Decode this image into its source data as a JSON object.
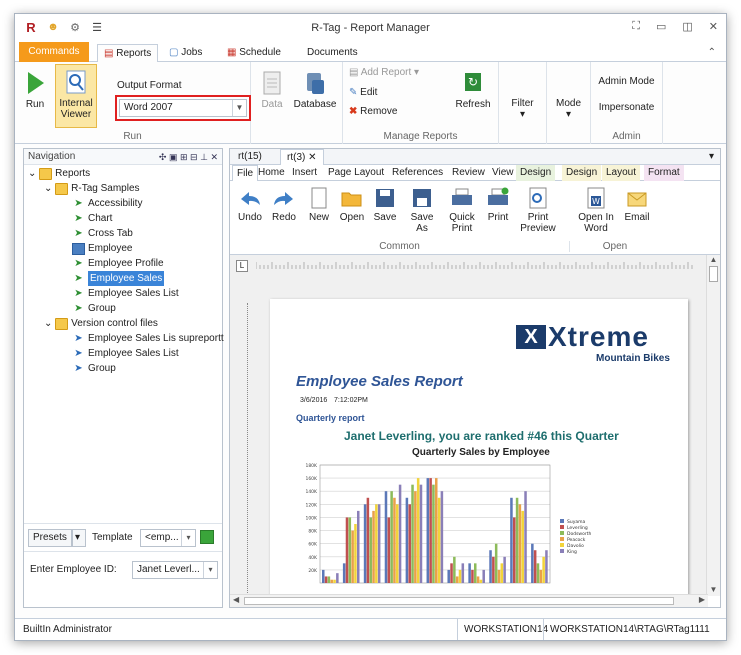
{
  "window": {
    "title": "R-Tag - Report Manager"
  },
  "tabs": [
    "Commands",
    "Reports",
    "Jobs",
    "Schedule",
    "Documents"
  ],
  "ribbon": {
    "run": "Run",
    "internal_viewer_line1": "Internal",
    "internal_viewer_line2": "Viewer",
    "output_format_label": "Output Format",
    "output_format_value": "Word 2007",
    "run_group": "Run",
    "data": "Data",
    "database": "Database",
    "add_report": "Add Report",
    "edit": "Edit",
    "remove": "Remove",
    "refresh": "Refresh",
    "manage_group": "Manage Reports",
    "filter": "Filter",
    "mode": "Mode",
    "admin_mode": "Admin Mode",
    "impersonate": "Impersonate",
    "admin_group": "Admin"
  },
  "navigation": {
    "title": "Navigation",
    "items": [
      "Reports",
      "R-Tag Samples",
      "Accessibility",
      "Chart",
      "Cross Tab",
      "Employee",
      "Employee  Profile",
      "Employee  Sales",
      "Employee Sales List",
      "Group",
      "Version control files",
      "Employee Sales Lis  supreportt",
      "Employee Sales List",
      "Group"
    ],
    "presets": "Presets",
    "template_label": "Template",
    "template_value": "<emp...",
    "employee_id_label": "Enter Employee ID:",
    "employee_id_value": "Janet Leverl..."
  },
  "doc": {
    "tabs": [
      "rt(15)",
      "rt(3)"
    ],
    "ribbon_tabs": [
      "File",
      "Home",
      "Insert",
      "Page Layout",
      "References",
      "Review",
      "View",
      "Design",
      "Design",
      "Layout",
      "Format"
    ],
    "buttons": [
      "Undo",
      "Redo",
      "New",
      "Open",
      "Save",
      "Save As",
      "Quick Print",
      "Print",
      "Print Preview",
      "Open In Word",
      "Email"
    ],
    "common_group": "Common",
    "open_group": "Open"
  },
  "report": {
    "logo_main": "Xtreme",
    "logo_sub": "Mountain Bikes",
    "title": "Employee Sales Report",
    "date": "3/6/2016",
    "time": "7:12:02PM",
    "quarterly": "Quarterly report",
    "headline": "Janet Leverling, you are ranked #46 this Quarter",
    "chart_title": "Quarterly Sales by Employee"
  },
  "chart_data": {
    "type": "bar",
    "title": "Quarterly Sales by Employee",
    "y_ticks": [
      "180K",
      "160K",
      "140K",
      "120K",
      "100K",
      "80K",
      "60K",
      "40K",
      "20K"
    ],
    "ylim": [
      0,
      180000
    ],
    "series": [
      {
        "name": "Suyama",
        "color": "#5b78b8",
        "values": [
          20000,
          30000,
          120000,
          140000,
          130000,
          160000,
          20000,
          30000,
          50000,
          130000,
          60000
        ]
      },
      {
        "name": "Leverling",
        "color": "#c05050",
        "values": [
          10000,
          100000,
          130000,
          100000,
          120000,
          160000,
          30000,
          20000,
          40000,
          100000,
          50000
        ]
      },
      {
        "name": "Dodsworth",
        "color": "#8dbb5a",
        "values": [
          10000,
          100000,
          100000,
          140000,
          150000,
          150000,
          40000,
          30000,
          60000,
          130000,
          30000
        ]
      },
      {
        "name": "Peacock",
        "color": "#e9a14a",
        "values": [
          5000,
          80000,
          110000,
          130000,
          140000,
          160000,
          10000,
          10000,
          20000,
          120000,
          20000
        ]
      },
      {
        "name": "Davolio",
        "color": "#f2d43a",
        "values": [
          5000,
          90000,
          120000,
          120000,
          160000,
          130000,
          20000,
          5000,
          30000,
          110000,
          40000
        ]
      },
      {
        "name": "King",
        "color": "#8a7fb8",
        "values": [
          15000,
          110000,
          120000,
          150000,
          150000,
          140000,
          30000,
          20000,
          40000,
          140000,
          50000
        ]
      }
    ]
  },
  "status": {
    "user": "BuiltIn Administrator",
    "workstation": "WORKSTATION14",
    "path": "WORKSTATION14\\RTAG\\RTag1111"
  }
}
